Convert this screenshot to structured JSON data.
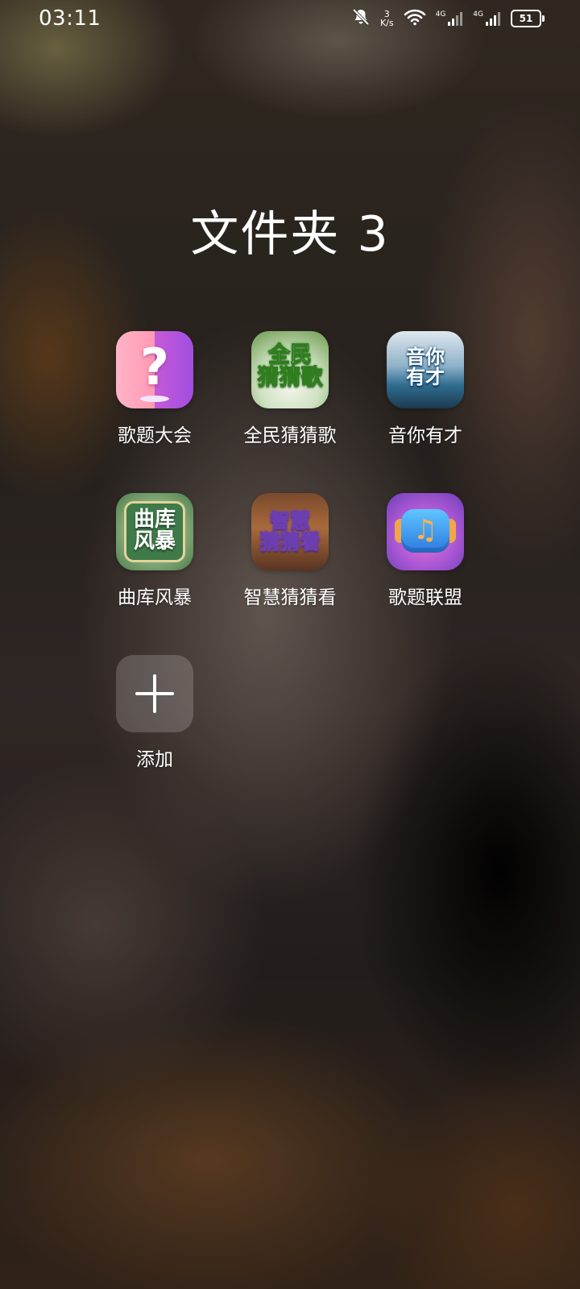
{
  "status_bar": {
    "time": "03:11",
    "network_speed_value": "3",
    "network_speed_unit": "K/s",
    "signal_1_label": "4G",
    "signal_2_label": "4G",
    "battery_level": "51",
    "icons": [
      "mute-bell-icon",
      "wifi-icon",
      "signal-icon",
      "signal-icon",
      "battery-icon"
    ]
  },
  "folder": {
    "title": "文件夹 3"
  },
  "apps": [
    {
      "label": "歌题大会",
      "icon_text": "?"
    },
    {
      "label": "全民猜猜歌",
      "icon_text": "全民\n猜猜歌"
    },
    {
      "label": "音你有才",
      "icon_text": "音你\n有才"
    },
    {
      "label": "曲库风暴",
      "icon_text": "曲库\n风暴"
    },
    {
      "label": "智慧猜猜看",
      "icon_text": "智慧\n猜猜看"
    },
    {
      "label": "歌题联盟",
      "icon_text": "♫"
    }
  ],
  "add_button": {
    "label": "添加"
  }
}
